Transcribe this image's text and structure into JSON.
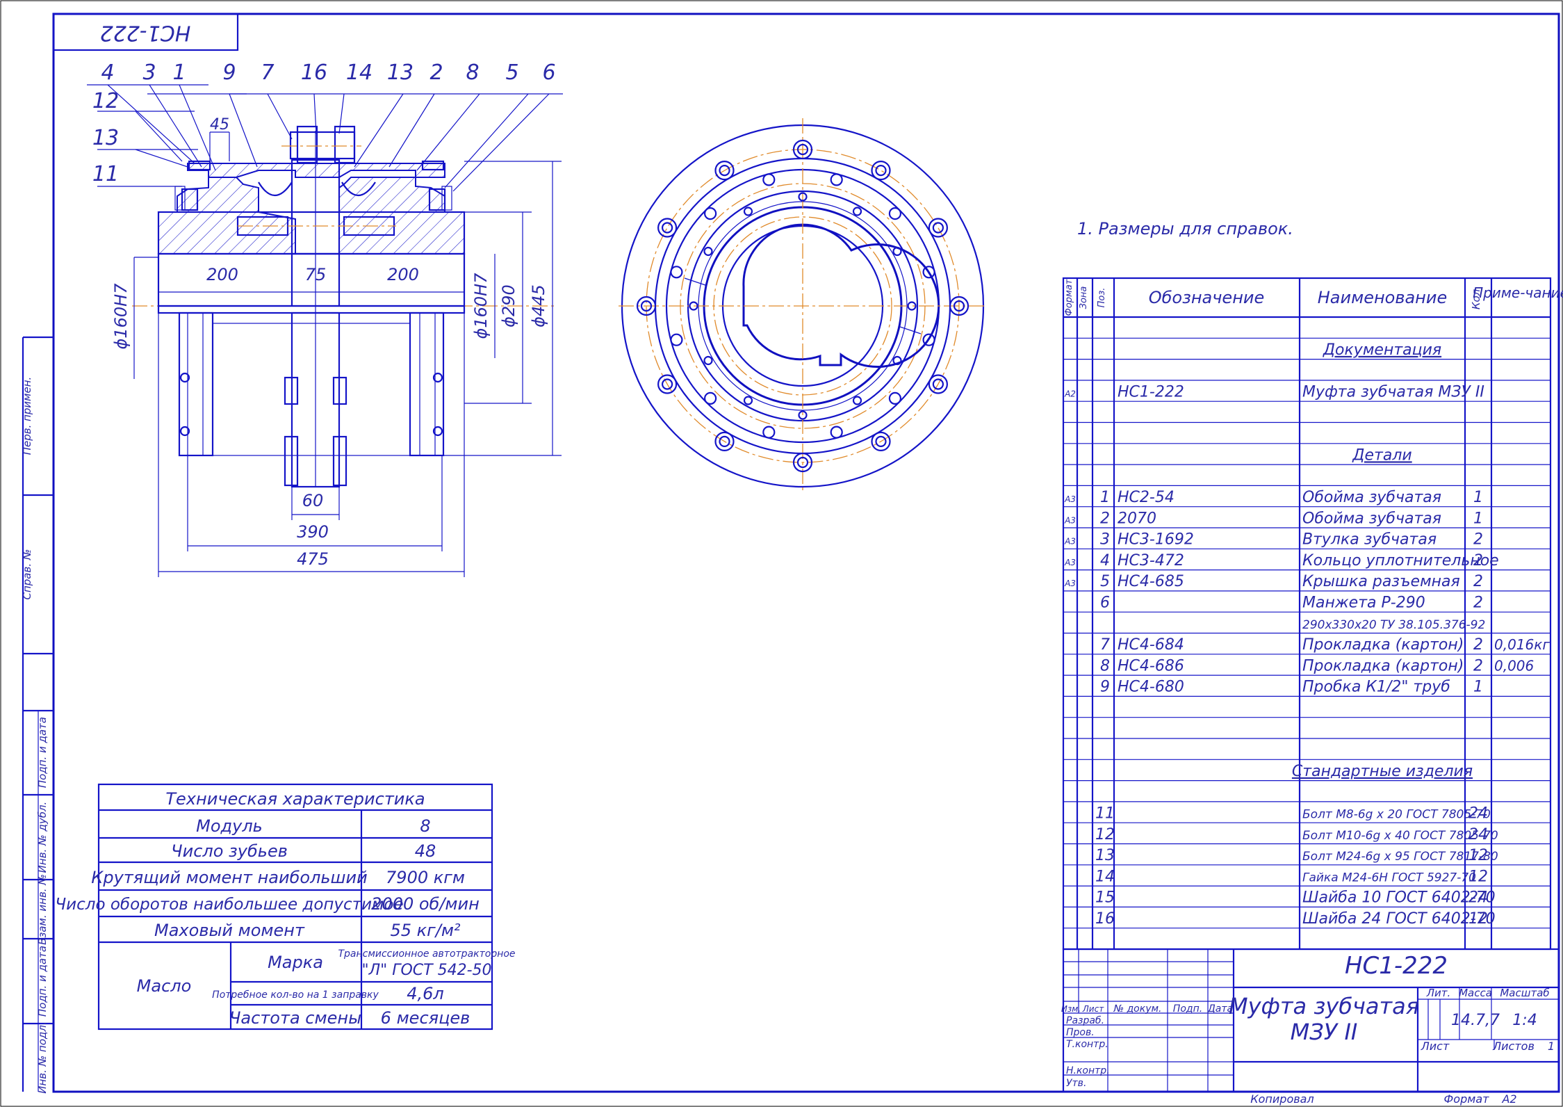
{
  "stamp_top": "НС1-222",
  "note": "1. Размеры для справок.",
  "side_labels": [
    "Перв. примен.",
    "Справ. №",
    "Подп. и дата",
    "Инв. № дубл.",
    "Взам. инв. №",
    "Подп. и дата",
    "Инв. № подл."
  ],
  "callouts": [
    "4",
    "3",
    "1",
    "9",
    "7",
    "16",
    "14",
    "13",
    "2",
    "8",
    "5",
    "6",
    "12",
    "13",
    "11"
  ],
  "dims": {
    "d45": "45",
    "d200a": "200",
    "d75": "75",
    "d200b": "200",
    "d60": "60",
    "d390": "390",
    "d475": "475",
    "dbore_left": "ϕ160H7",
    "dbore_right": "ϕ160H7",
    "d290": "ϕ290",
    "d445": "ϕ445"
  },
  "tech_table": {
    "title": "Техническая характеристика",
    "rows": [
      {
        "label": "Модуль",
        "value": "8"
      },
      {
        "label": "Число зубьев",
        "value": "48"
      },
      {
        "label": "Крутящий момент наибольший",
        "value": "7900 кгм"
      },
      {
        "label": "Число оборотов наибольшее допустимое",
        "value": "2000 об/мин"
      },
      {
        "label": "Маховый момент",
        "value": "55 кг/м²"
      }
    ],
    "oil": {
      "label": "Масло",
      "mark_label": "Марка",
      "mark_value_1": "Трансмиссионное автотракторное",
      "mark_value_2": "\"Л\" ГОСТ 542-50",
      "qty_label": "Потребное кол-во на 1 заправку",
      "qty_value": "4,6л",
      "freq_label": "Частота смены",
      "freq_value": "6 месяцев"
    }
  },
  "spec": {
    "headers": {
      "format": "Формат",
      "zone": "Зона",
      "pos": "Поз.",
      "designation": "Обозначение",
      "name": "Наименование",
      "qty": "Кол.",
      "note": "Приме-чание"
    },
    "rows": [
      {
        "fmt": "",
        "pos": "",
        "des": "",
        "name": "",
        "qty": "",
        "note": ""
      },
      {
        "fmt": "",
        "pos": "",
        "des": "",
        "name": "Документация",
        "qty": "",
        "note": "",
        "heading": true
      },
      {
        "fmt": "",
        "pos": "",
        "des": "",
        "name": "",
        "qty": "",
        "note": ""
      },
      {
        "fmt": "А2",
        "pos": "",
        "des": "НС1-222",
        "name": "Муфта зубчатая МЗУ II",
        "qty": "",
        "note": ""
      },
      {
        "fmt": "",
        "pos": "",
        "des": "",
        "name": "",
        "qty": "",
        "note": ""
      },
      {
        "fmt": "",
        "pos": "",
        "des": "",
        "name": "",
        "qty": "",
        "note": ""
      },
      {
        "fmt": "",
        "pos": "",
        "des": "",
        "name": "Детали",
        "qty": "",
        "note": "",
        "heading": true
      },
      {
        "fmt": "",
        "pos": "",
        "des": "",
        "name": "",
        "qty": "",
        "note": ""
      },
      {
        "fmt": "А3",
        "pos": "1",
        "des": "НС2-54",
        "name": "Обойма зубчатая",
        "qty": "1",
        "note": ""
      },
      {
        "fmt": "А3",
        "pos": "2",
        "des": "2070",
        "name": "Обойма зубчатая",
        "qty": "1",
        "note": ""
      },
      {
        "fmt": "А3",
        "pos": "3",
        "des": "НС3-1692",
        "name": "Втулка зубчатая",
        "qty": "2",
        "note": ""
      },
      {
        "fmt": "А3",
        "pos": "4",
        "des": "НС3-472",
        "name": "Кольцо уплотнительное",
        "qty": "2",
        "note": ""
      },
      {
        "fmt": "А3",
        "pos": "5",
        "des": "НС4-685",
        "name": "Крышка разъемная",
        "qty": "2",
        "note": ""
      },
      {
        "fmt": "",
        "pos": "6",
        "des": "",
        "name": "Манжета Р-290",
        "qty": "2",
        "note": ""
      },
      {
        "fmt": "",
        "pos": "",
        "des": "",
        "name": "290х330х20 ТУ 38.105.376-92",
        "qty": "",
        "note": ""
      },
      {
        "fmt": "",
        "pos": "7",
        "des": "НС4-684",
        "name": "Прокладка (картон)",
        "qty": "2",
        "note": "0,016кг"
      },
      {
        "fmt": "",
        "pos": "8",
        "des": "НС4-686",
        "name": "Прокладка (картон)",
        "qty": "2",
        "note": "0,006"
      },
      {
        "fmt": "",
        "pos": "9",
        "des": "НС4-680",
        "name": "Пробка К1/2\" труб",
        "qty": "1",
        "note": ""
      },
      {
        "fmt": "",
        "pos": "",
        "des": "",
        "name": "",
        "qty": "",
        "note": ""
      },
      {
        "fmt": "",
        "pos": "",
        "des": "",
        "name": "",
        "qty": "",
        "note": ""
      },
      {
        "fmt": "",
        "pos": "",
        "des": "",
        "name": "",
        "qty": "",
        "note": ""
      },
      {
        "fmt": "",
        "pos": "",
        "des": "",
        "name": "Стандартные изделия",
        "qty": "",
        "note": "",
        "heading": true
      },
      {
        "fmt": "",
        "pos": "",
        "des": "",
        "name": "",
        "qty": "",
        "note": ""
      },
      {
        "fmt": "",
        "pos": "11",
        "des": "",
        "name": "Болт М8-6g x 20 ГОСТ 7805-70",
        "qty": "24",
        "note": ""
      },
      {
        "fmt": "",
        "pos": "12",
        "des": "",
        "name": "Болт М10-6g x 40 ГОСТ 7805-70",
        "qty": "24",
        "note": ""
      },
      {
        "fmt": "",
        "pos": "13",
        "des": "",
        "name": "Болт М24-6g x 95 ГОСТ 7817-80",
        "qty": "12",
        "note": ""
      },
      {
        "fmt": "",
        "pos": "14",
        "des": "",
        "name": "Гайка М24-6Н ГОСТ 5927-70",
        "qty": "12",
        "note": ""
      },
      {
        "fmt": "",
        "pos": "15",
        "des": "",
        "name": "Шайба 10 ГОСТ 6402-70",
        "qty": "24",
        "note": ""
      },
      {
        "fmt": "",
        "pos": "16",
        "des": "",
        "name": "Шайба 24 ГОСТ 6402-70",
        "qty": "12",
        "note": ""
      },
      {
        "fmt": "",
        "pos": "",
        "des": "",
        "name": "",
        "qty": "",
        "note": ""
      }
    ]
  },
  "title_block": {
    "code": "НС1-222",
    "name_line1": "Муфта зубчатая",
    "name_line2": "МЗУ II",
    "lit": "Лит.",
    "mass_label": "Масса",
    "mass": "14.7,7",
    "scale_label": "Масштаб",
    "scale": "1:4",
    "sheet_label": "Лист",
    "sheets_label": "Листов",
    "sheets": "1",
    "cols": [
      "Изм.",
      "Лист",
      "№ докум.",
      "Подп.",
      "Дата"
    ],
    "roles": [
      "Разраб.",
      "Пров.",
      "Т.контр.",
      "",
      "Н.контр.",
      "Утв."
    ],
    "copied": "Копировал",
    "format_label": "Формат",
    "format": "А2"
  }
}
